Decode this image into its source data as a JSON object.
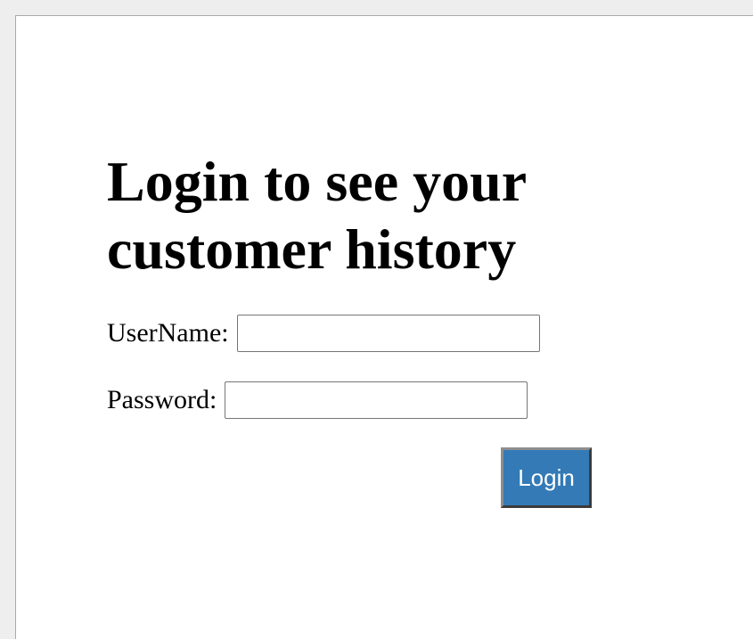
{
  "heading": "Login to see your customer history",
  "form": {
    "username_label": "UserName:",
    "username_value": "",
    "password_label": "Password:",
    "password_value": "",
    "submit_label": "Login"
  },
  "colors": {
    "button_bg": "#337ab7",
    "button_text": "#ffffff",
    "page_bg": "#ffffff",
    "outer_bg": "#eeeeee"
  }
}
